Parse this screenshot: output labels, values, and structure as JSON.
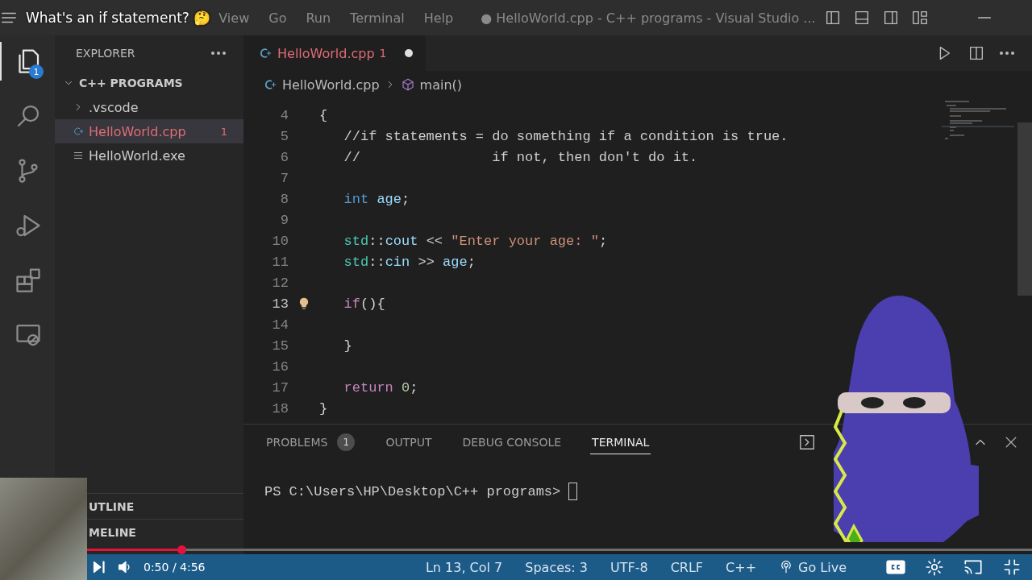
{
  "video_overlay": {
    "title": "What's an if statement? 🤔",
    "progress": {
      "level": 0.1
    },
    "time": "0:50 / 4:56"
  },
  "title_bar": {
    "menu": [
      "View",
      "Go",
      "Run",
      "Terminal",
      "Help"
    ],
    "title": "● HelloWorld.cpp - C++ programs - Visual Studio ..."
  },
  "activity_bar": [
    {
      "kind": "files",
      "selected": true,
      "badge": "1"
    },
    {
      "kind": "search",
      "selected": false
    },
    {
      "kind": "source-control",
      "selected": false
    },
    {
      "kind": "run",
      "selected": false
    },
    {
      "kind": "extensions",
      "selected": false
    },
    {
      "kind": "remote",
      "selected": false
    }
  ],
  "sidebar": {
    "title": "EXPLORER",
    "folder": {
      "label": "C++ PROGRAMS",
      "expanded": true,
      "children": [
        {
          "kind": "folder",
          "label": ".vscode",
          "expanded": false,
          "selected": false
        },
        {
          "kind": "cpp",
          "label": "HelloWorld.cpp",
          "selected": true,
          "problems": "1"
        },
        {
          "kind": "exe",
          "label": "HelloWorld.exe",
          "selected": false
        }
      ]
    },
    "sections": [
      "UTLINE",
      "MELINE"
    ]
  },
  "editor": {
    "tab": {
      "label": "HelloWorld.cpp",
      "problems": "1",
      "dirty": true
    },
    "breadcrumbs": {
      "file": "HelloWorld.cpp",
      "symbol": "main()"
    },
    "lines": [
      {
        "number": "4",
        "lightbulb": false,
        "tokens": [
          {
            "kind": "punct",
            "text": "{"
          }
        ]
      },
      {
        "number": "5",
        "lightbulb": false,
        "tokens": [
          {
            "kind": "comment",
            "text": "   //if statements = do something if a condition is true."
          }
        ]
      },
      {
        "number": "6",
        "lightbulb": false,
        "tokens": [
          {
            "kind": "comment",
            "text": "   //                if not, then don't do it."
          }
        ]
      },
      {
        "number": "7",
        "lightbulb": false
      },
      {
        "number": "8",
        "lightbulb": false,
        "tokens": [
          {
            "kind": "keyword",
            "text": "   int"
          },
          {
            "kind": "variable",
            "text": " age"
          },
          {
            "kind": "punct",
            "text": ";"
          }
        ]
      },
      {
        "number": "9",
        "lightbulb": false
      },
      {
        "number": "10",
        "lightbulb": false,
        "tokens": [
          {
            "kind": "namespace",
            "text": "   std"
          },
          {
            "kind": "punct",
            "text": "::"
          },
          {
            "kind": "variable",
            "text": "cout"
          },
          {
            "kind": "punct",
            "text": " << "
          },
          {
            "kind": "string",
            "text": "\"Enter your age: \""
          },
          {
            "kind": "punct",
            "text": ";"
          }
        ]
      },
      {
        "number": "11",
        "lightbulb": false,
        "tokens": [
          {
            "kind": "namespace",
            "text": "   std"
          },
          {
            "kind": "punct",
            "text": "::"
          },
          {
            "kind": "variable",
            "text": "cin"
          },
          {
            "kind": "punct",
            "text": " >> "
          },
          {
            "kind": "variable",
            "text": "age"
          },
          {
            "kind": "punct",
            "text": ";"
          }
        ]
      },
      {
        "number": "12",
        "lightbulb": false
      },
      {
        "number": "13",
        "lightbulb": true,
        "tokens": [
          {
            "kind": "control",
            "text": "   if"
          },
          {
            "kind": "punct",
            "text": "(){"
          }
        ]
      },
      {
        "number": "14",
        "lightbulb": false
      },
      {
        "number": "15",
        "lightbulb": false,
        "tokens": [
          {
            "kind": "punct",
            "text": "   }"
          }
        ]
      },
      {
        "number": "16",
        "lightbulb": false
      },
      {
        "number": "17",
        "lightbulb": false,
        "tokens": [
          {
            "kind": "control",
            "text": "   return"
          },
          {
            "kind": "number",
            "text": " 0"
          },
          {
            "kind": "punct",
            "text": ";"
          }
        ]
      },
      {
        "number": "18",
        "lightbulb": false,
        "tokens": [
          {
            "kind": "punct",
            "text": "}"
          }
        ]
      }
    ]
  },
  "panel": {
    "tabs": [
      {
        "label": "PROBLEMS",
        "badge": "1",
        "selected": false
      },
      {
        "label": "OUTPUT",
        "selected": false
      },
      {
        "label": "DEBUG CONSOLE",
        "selected": false
      },
      {
        "label": "TERMINAL",
        "selected": true
      }
    ],
    "terminal_prompt": "PS C:\\Users\\HP\\Desktop\\C++ programs>"
  },
  "status_bar": [
    "Ln 13, Col 7",
    "Spaces: 3",
    "UTF-8",
    "CRLF",
    "C++",
    "Go Live"
  ]
}
